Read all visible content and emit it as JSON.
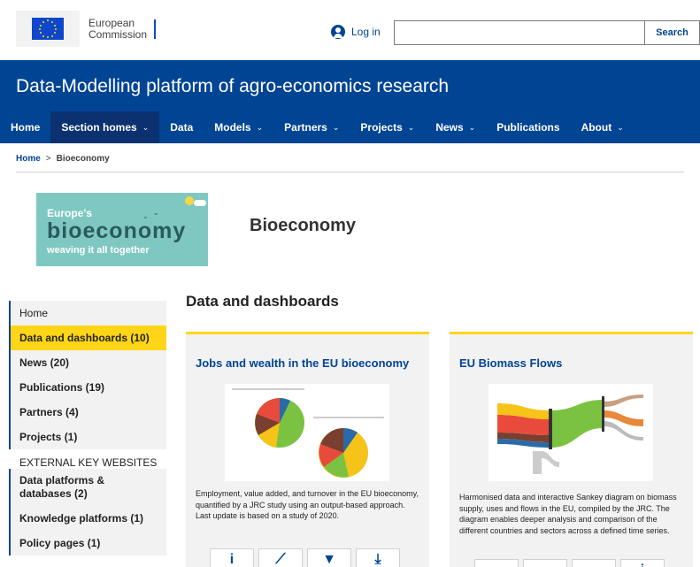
{
  "topbar": {
    "logo_line1": "European",
    "logo_line2": "Commission",
    "login_label": "Log in",
    "search_placeholder": "",
    "search_label": "Search"
  },
  "site": {
    "title": "Data-Modelling platform of agro-economics research"
  },
  "nav": [
    {
      "label": "Home",
      "dropdown": false
    },
    {
      "label": "Section homes",
      "dropdown": true,
      "active": true
    },
    {
      "label": "Data",
      "dropdown": false
    },
    {
      "label": "Models",
      "dropdown": true
    },
    {
      "label": "Partners",
      "dropdown": true
    },
    {
      "label": "Projects",
      "dropdown": true
    },
    {
      "label": "News",
      "dropdown": true
    },
    {
      "label": "Publications",
      "dropdown": false
    },
    {
      "label": "About",
      "dropdown": true
    }
  ],
  "breadcrumb": {
    "home": "Home",
    "separator": ">",
    "current": "Bioeconomy"
  },
  "banner": {
    "line1": "Europe's",
    "line2": "bioeconomy",
    "line3": "weaving it all together"
  },
  "page": {
    "title": "Bioeconomy"
  },
  "sidebar": {
    "items": [
      {
        "label": "Home"
      },
      {
        "label": "Data and dashboards (10)",
        "active": true
      },
      {
        "label": "News (20)"
      },
      {
        "label": "Publications (19)"
      },
      {
        "label": "Partners (4)"
      },
      {
        "label": "Projects (1)"
      }
    ],
    "external_header": "EXTERNAL KEY WEBSITES",
    "external_items": [
      {
        "label": "Data platforms & databases (2)"
      },
      {
        "label": "Knowledge platforms (1)"
      },
      {
        "label": "Policy pages (1)"
      }
    ]
  },
  "section": {
    "title": "Data and dashboards"
  },
  "cards": [
    {
      "title": "Jobs and wealth in the EU bioeconomy",
      "description": "Employment, value added, and turnover in the EU bioeconomy, quantified by a JRC study using an output-based approach. Last update is based on a study of 2020.",
      "actions": [
        {
          "icon": "info-icon",
          "glyph": "i"
        },
        {
          "icon": "chart-icon",
          "glyph": "⟋"
        },
        {
          "icon": "filter-icon",
          "glyph": "▼"
        },
        {
          "icon": "download-icon",
          "glyph": "⤓"
        }
      ]
    },
    {
      "title": "EU Biomass Flows",
      "description": "Harmonised data and interactive Sankey diagram on biomass supply, uses and flows in the EU, compiled by the JRC. The diagram enables deeper analysis and comparison of the different countries and sectors across a defined time series.",
      "actions": [
        {
          "icon": "blank-icon",
          "glyph": ""
        },
        {
          "icon": "blank-icon",
          "glyph": ""
        },
        {
          "icon": "blank-icon",
          "glyph": ""
        },
        {
          "icon": "info-icon",
          "glyph": "i"
        }
      ]
    }
  ],
  "colors": {
    "brand": "#004494",
    "accent": "#ffd617",
    "active_nav": "#0b3170"
  }
}
